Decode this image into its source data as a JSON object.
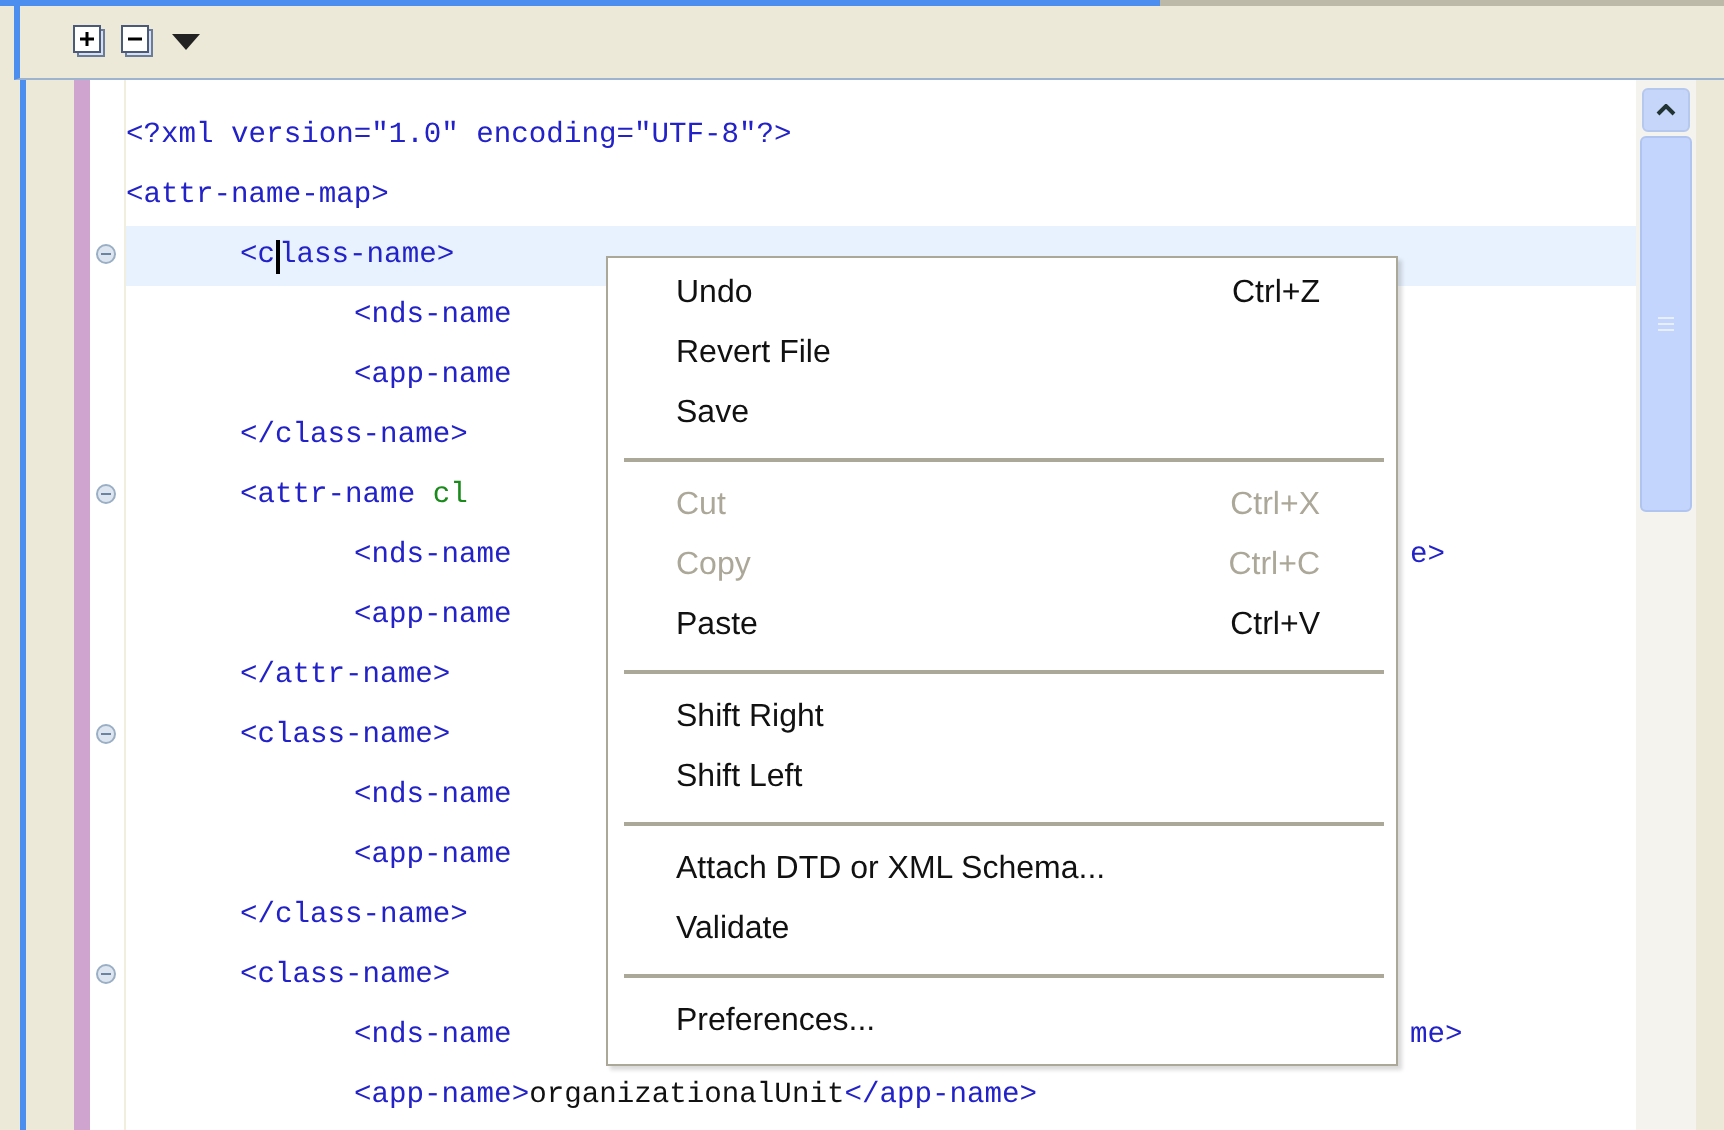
{
  "code_lines": [
    {
      "foldable": false,
      "current": false,
      "segments": [
        {
          "kind": "tag",
          "text": "<?xml version=\"1.0\" encoding=\"UTF-8\"?>"
        }
      ]
    },
    {
      "foldable": false,
      "current": false,
      "segments": [
        {
          "kind": "tag",
          "text": "<attr-name-map>"
        }
      ],
      "children": [
        {
          "foldable": true,
          "current": true,
          "segments": [
            {
              "kind": "tag",
              "text": "<c"
            },
            {
              "kind": "cursor"
            },
            {
              "kind": "tag",
              "text": "lass-name>"
            }
          ],
          "children": [
            {
              "foldable": false,
              "current": false,
              "segments": [
                {
                  "kind": "tag",
                  "text": "<nds-name"
                }
              ]
            },
            {
              "foldable": false,
              "current": false,
              "segments": [
                {
                  "kind": "tag",
                  "text": "<app-name"
                }
              ]
            }
          ]
        },
        {
          "foldable": false,
          "current": false,
          "segments": [
            {
              "kind": "tag",
              "text": "</class-name>"
            }
          ]
        },
        {
          "foldable": true,
          "current": false,
          "segments": [
            {
              "kind": "tag",
              "text": "<attr-name "
            },
            {
              "kind": "attr",
              "text": "cl"
            }
          ],
          "children": [
            {
              "foldable": false,
              "current": false,
              "segments": [
                {
                  "kind": "tag",
                  "text": "<nds-name"
                }
              ],
              "tail": "e>"
            },
            {
              "foldable": false,
              "current": false,
              "segments": [
                {
                  "kind": "tag",
                  "text": "<app-name"
                }
              ]
            }
          ]
        },
        {
          "foldable": false,
          "current": false,
          "segments": [
            {
              "kind": "tag",
              "text": "</attr-name>"
            }
          ]
        },
        {
          "foldable": true,
          "current": false,
          "segments": [
            {
              "kind": "tag",
              "text": "<class-name>"
            }
          ],
          "children": [
            {
              "foldable": false,
              "current": false,
              "segments": [
                {
                  "kind": "tag",
                  "text": "<nds-name"
                }
              ]
            },
            {
              "foldable": false,
              "current": false,
              "segments": [
                {
                  "kind": "tag",
                  "text": "<app-name"
                }
              ]
            }
          ]
        },
        {
          "foldable": false,
          "current": false,
          "segments": [
            {
              "kind": "tag",
              "text": "</class-name>"
            }
          ]
        },
        {
          "foldable": true,
          "current": false,
          "segments": [
            {
              "kind": "tag",
              "text": "<class-name>"
            }
          ],
          "children": [
            {
              "foldable": false,
              "current": false,
              "segments": [
                {
                  "kind": "tag",
                  "text": "<nds-name"
                }
              ],
              "tail": "me>"
            },
            {
              "foldable": false,
              "current": false,
              "segments": [
                {
                  "kind": "tag",
                  "text": "<app-name>"
                },
                {
                  "kind": "text",
                  "text": "organizationalUnit"
                },
                {
                  "kind": "tag",
                  "text": "</app-name>"
                }
              ]
            }
          ]
        }
      ]
    }
  ],
  "context_menu": [
    {
      "kind": "item",
      "label": "Undo",
      "shortcut": "Ctrl+Z",
      "disabled": false
    },
    {
      "kind": "item",
      "label": "Revert File",
      "disabled": false
    },
    {
      "kind": "item",
      "label": "Save",
      "disabled": false
    },
    {
      "kind": "separator"
    },
    {
      "kind": "item",
      "label": "Cut",
      "shortcut": "Ctrl+X",
      "disabled": true
    },
    {
      "kind": "item",
      "label": "Copy",
      "shortcut": "Ctrl+C",
      "disabled": true
    },
    {
      "kind": "item",
      "label": "Paste",
      "shortcut": "Ctrl+V",
      "disabled": false
    },
    {
      "kind": "separator"
    },
    {
      "kind": "item",
      "label": "Shift Right",
      "disabled": false
    },
    {
      "kind": "item",
      "label": "Shift Left",
      "disabled": false
    },
    {
      "kind": "separator"
    },
    {
      "kind": "item",
      "label": "Attach DTD or XML Schema...",
      "disabled": false
    },
    {
      "kind": "item",
      "label": "Validate",
      "disabled": false
    },
    {
      "kind": "separator"
    },
    {
      "kind": "item",
      "label": "Preferences...",
      "disabled": false
    }
  ]
}
